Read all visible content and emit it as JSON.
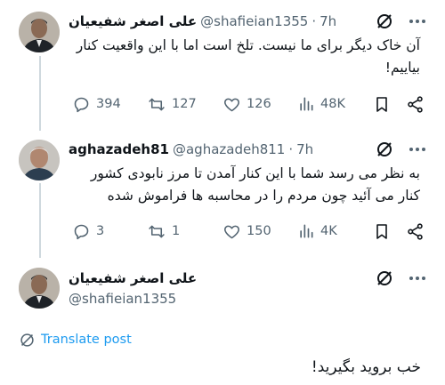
{
  "tweets": [
    {
      "name": "علی اصغر شفیعیان",
      "handle": "@shafieian1355",
      "time": "7h",
      "text": "آن خاک دیگر برای ما نیست. تلخ است اما با این واقعیت کنار بیاییم!",
      "replies": "394",
      "reposts": "127",
      "likes": "126",
      "views": "48K"
    },
    {
      "name": "aghazadeh81",
      "handle": "@aghazadeh811",
      "time": "7h",
      "text": "به نظر می رسد شما با این کنار آمدن تا مرز نابودی کشور کنار می آئید چون مردم را در محاسبه ها فراموش شده",
      "replies": "3",
      "reposts": "1",
      "likes": "150",
      "views": "4K"
    }
  ],
  "main": {
    "name": "علی اصغر شفیعیان",
    "handle": "@shafieian1355",
    "translate_label": "Translate post",
    "text": "خب بروید بگیرید!"
  },
  "colors": {
    "accent": "#1d9bf0",
    "muted": "#536471",
    "line": "#cfd9de"
  },
  "icons": [
    "grok-icon",
    "more-icon",
    "reply-icon",
    "repost-icon",
    "like-icon",
    "views-icon",
    "bookmark-icon",
    "share-icon",
    "globe-icon"
  ]
}
